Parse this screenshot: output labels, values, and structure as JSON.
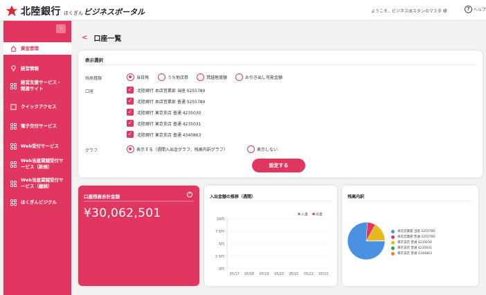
{
  "header": {
    "bank_name": "北陸銀行",
    "portal_sub": "ほくぎん",
    "portal_name": "ビジネスポータル",
    "welcome": "ようこそ、ビジネスIBスタンのマスタ 様",
    "help_label": "ヘルプ",
    "help_symbol": "?"
  },
  "sidebar": {
    "collapse_symbol": "‹",
    "items": [
      {
        "label": "資金管理",
        "icon": "home-icon",
        "active": true
      },
      {
        "label": "経営情報",
        "icon": "lightbulb-icon",
        "active": false
      },
      {
        "label": "経営支援サービス・関連サイト",
        "icon": "grid-icon",
        "active": false
      },
      {
        "label": "クイックアクセス",
        "icon": "square-icon",
        "active": false
      },
      {
        "label": "電子交付サービス",
        "icon": "grid-icon",
        "active": false
      },
      {
        "label": "Web受付サービス",
        "icon": "grid-icon",
        "active": false
      },
      {
        "label": "Web当座貸越受付サービス（新規）",
        "icon": "grid-icon",
        "active": false
      },
      {
        "label": "Web当座貸越受付サービス（継続）",
        "icon": "grid-icon",
        "active": false
      },
      {
        "label": "ほくぎんビジクル",
        "icon": "grid-icon",
        "active": false
      }
    ]
  },
  "page": {
    "back_symbol": "<",
    "title": "口座一覧"
  },
  "display_selection": {
    "title": "表示選択",
    "balance_type_label": "残高種類",
    "balance_options": [
      {
        "label": "当日残",
        "selected": true
      },
      {
        "label": "うち他店券",
        "selected": false
      },
      {
        "label": "貸越極度額",
        "selected": false
      },
      {
        "label": "お引き出し可能金額",
        "selected": false
      }
    ],
    "account_label": "口座",
    "accounts": [
      "北陸銀行 本店営業部 当座 5255780",
      "北陸銀行 本店営業部 普通 5255780",
      "北陸銀行 東京支店 普通 4235030",
      "北陸銀行 東京支店 普通 4235031",
      "北陸銀行 東京支店 普通 4340863"
    ],
    "graph_label": "グラフ",
    "graph_options": [
      {
        "label": "表示する（週間入出金グラフ、残高内訳グラフ）",
        "selected": true
      },
      {
        "label": "表示しない",
        "selected": false
      }
    ],
    "submit_label": "設定する"
  },
  "total": {
    "title": "口座残高合計金額",
    "info_symbol": "?",
    "amount": "¥30,062,501"
  },
  "trend": {
    "title": "入出金額の推移（週間）"
  },
  "breakdown": {
    "title": "残高内訳"
  },
  "colors": {
    "brand": "#e0365f",
    "deposit": "#4a90e2",
    "withdrawal": "#e0365f"
  },
  "chart_data": [
    {
      "type": "bar",
      "title": "入出金額の推移（週間）",
      "categories": [
        "05/17",
        "05/18",
        "05/19",
        "05/20",
        "05/21",
        "05/22",
        "05/23"
      ],
      "series": [
        {
          "name": "入金",
          "values": [
            0,
            0,
            0,
            0,
            0,
            0,
            0
          ],
          "color": "#4a90e2"
        },
        {
          "name": "出金",
          "values": [
            0,
            0,
            0,
            0,
            0,
            0,
            0
          ],
          "color": "#e0365f"
        }
      ],
      "yticks": [
        "0円",
        "2.5円",
        "5円",
        "7.5円",
        "10円"
      ],
      "ylim": [
        0,
        10
      ],
      "legend": "top-right",
      "grid": true
    },
    {
      "type": "pie",
      "title": "残高内訳",
      "labels": [
        "本店営業部 当座 5255780",
        "本店営業部 普通 5255780",
        "東京支店 普通 4235030",
        "東京支店 普通 4235031",
        "東京支店 普通 4340863"
      ],
      "values": [
        76,
        7,
        16.5,
        0.3,
        0.2
      ],
      "colors": [
        "#4a90e2",
        "#e0365f",
        "#e8b820",
        "#2e9e5b",
        "#f07f1a"
      ],
      "legend": "right"
    }
  ]
}
